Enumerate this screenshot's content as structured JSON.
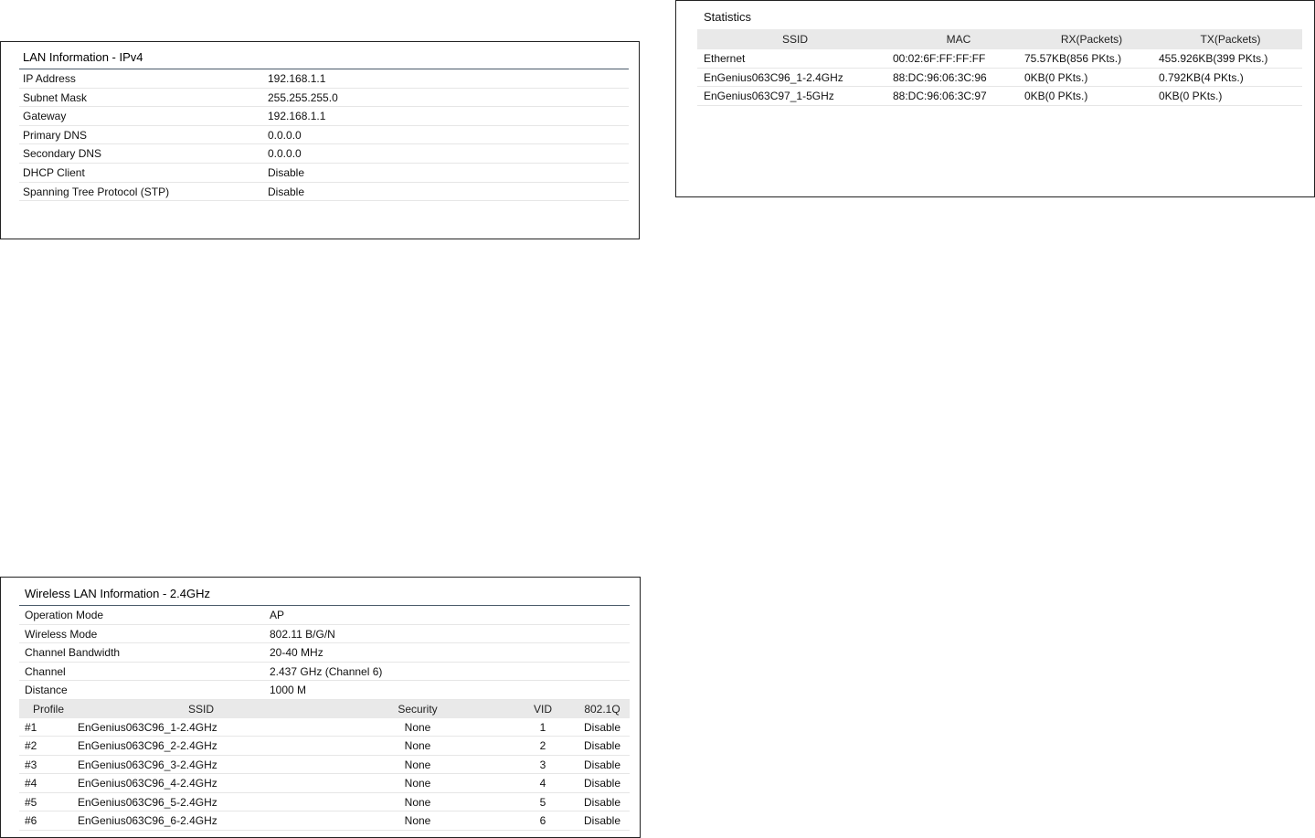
{
  "lan": {
    "title": "LAN Information - IPv4",
    "rows": [
      {
        "label": "IP Address",
        "value": "192.168.1.1"
      },
      {
        "label": "Subnet Mask",
        "value": "255.255.255.0"
      },
      {
        "label": "Gateway",
        "value": "192.168.1.1"
      },
      {
        "label": "Primary DNS",
        "value": "0.0.0.0"
      },
      {
        "label": "Secondary DNS",
        "value": "0.0.0.0"
      },
      {
        "label": "DHCP Client",
        "value": "Disable"
      },
      {
        "label": "Spanning Tree Protocol (STP)",
        "value": "Disable"
      }
    ]
  },
  "stats": {
    "title": "Statistics",
    "headers": [
      "SSID",
      "MAC",
      "RX(Packets)",
      "TX(Packets)"
    ],
    "rows": [
      [
        "Ethernet",
        "00:02:6F:FF:FF:FF",
        "75.57KB(856 PKts.)",
        "455.926KB(399 PKts.)"
      ],
      [
        "EnGenius063C96_1-2.4GHz",
        "88:DC:96:06:3C:96",
        "0KB(0 PKts.)",
        "0.792KB(4 PKts.)"
      ],
      [
        "EnGenius063C97_1-5GHz",
        "88:DC:96:06:3C:97",
        "0KB(0 PKts.)",
        "0KB(0 PKts.)"
      ]
    ]
  },
  "wlan": {
    "title": "Wireless LAN Information - 2.4GHz",
    "rows": [
      {
        "label": "Operation Mode",
        "value": "AP"
      },
      {
        "label": "Wireless Mode",
        "value": "802.11 B/G/N"
      },
      {
        "label": "Channel Bandwidth",
        "value": "20-40 MHz"
      },
      {
        "label": "Channel",
        "value": "2.437 GHz (Channel 6)"
      },
      {
        "label": "Distance",
        "value": "1000 M"
      }
    ],
    "profile_headers": [
      "Profile",
      "SSID",
      "Security",
      "VID",
      "802.1Q"
    ],
    "profiles": [
      [
        "#1",
        "EnGenius063C96_1-2.4GHz",
        "None",
        "1",
        "Disable"
      ],
      [
        "#2",
        "EnGenius063C96_2-2.4GHz",
        "None",
        "2",
        "Disable"
      ],
      [
        "#3",
        "EnGenius063C96_3-2.4GHz",
        "None",
        "3",
        "Disable"
      ],
      [
        "#4",
        "EnGenius063C96_4-2.4GHz",
        "None",
        "4",
        "Disable"
      ],
      [
        "#5",
        "EnGenius063C96_5-2.4GHz",
        "None",
        "5",
        "Disable"
      ],
      [
        "#6",
        "EnGenius063C96_6-2.4GHz",
        "None",
        "6",
        "Disable"
      ]
    ]
  }
}
